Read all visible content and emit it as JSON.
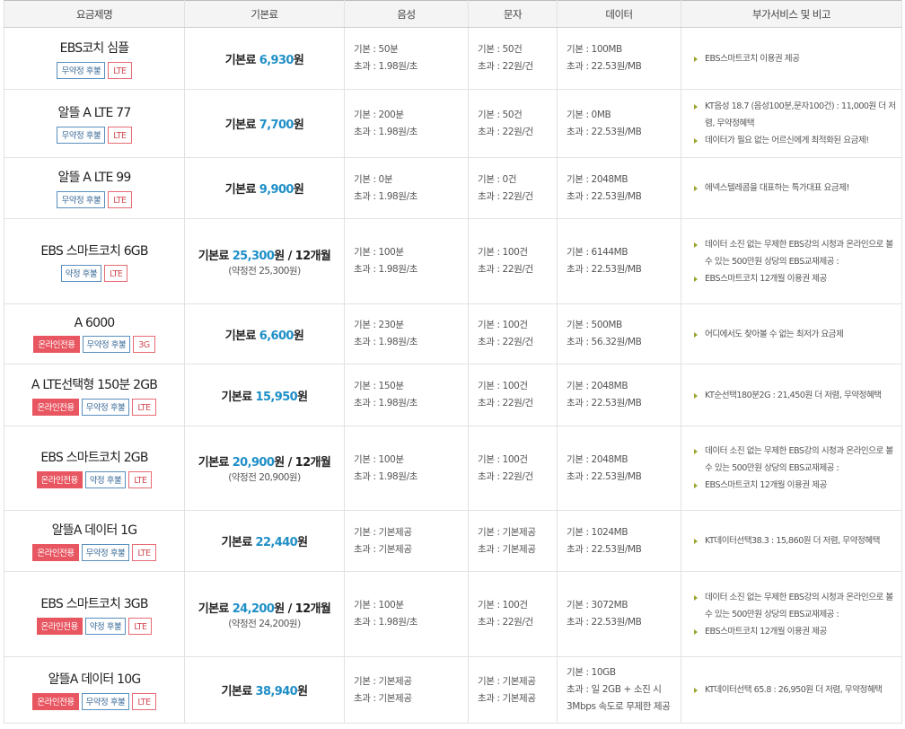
{
  "headers": [
    "요금제명",
    "기본료",
    "음성",
    "문자",
    "데이터",
    "부가서비스 및 비고"
  ],
  "plans": [
    {
      "name": "EBS코치 심플",
      "badges": [
        {
          "type": "contract",
          "label": "무약정 후불"
        },
        {
          "type": "net",
          "label": "LTE"
        }
      ],
      "fee": {
        "prefix": "기본료",
        "amount": "6,930",
        "unit": "원",
        "suffix": "",
        "sub": ""
      },
      "voice": [
        "기본 : 50분",
        "초과 : 1.98원/초"
      ],
      "sms": [
        "기본 : 50건",
        "초과 : 22원/건"
      ],
      "data": [
        "기본 : 100MB",
        "초과 : 22.53원/MB"
      ],
      "notes": [
        "EBS스마트코치 이용권 제공"
      ]
    },
    {
      "name": "알뜰 A LTE 77",
      "badges": [
        {
          "type": "contract",
          "label": "무약정 후불"
        },
        {
          "type": "net",
          "label": "LTE"
        }
      ],
      "fee": {
        "prefix": "기본료",
        "amount": "7,700",
        "unit": "원",
        "suffix": "",
        "sub": ""
      },
      "voice": [
        "기본 : 200분",
        "초과 : 1.98원/초"
      ],
      "sms": [
        "기본 : 50건",
        "초과 : 22원/건"
      ],
      "data": [
        "기본 : 0MB",
        "초과 : 22.53원/MB"
      ],
      "notes": [
        "KT음성 18.7 (음성100분,문자100건) : 11,000원 더 저렴, 무약정혜택",
        "데이터가 필요 없는 어르신에게 최적화된 요금제!"
      ]
    },
    {
      "name": "알뜰 A LTE 99",
      "badges": [
        {
          "type": "contract",
          "label": "무약정 후불"
        },
        {
          "type": "net",
          "label": "LTE"
        }
      ],
      "fee": {
        "prefix": "기본료",
        "amount": "9,900",
        "unit": "원",
        "suffix": "",
        "sub": ""
      },
      "voice": [
        "기본 : 0분",
        "초과 : 1.98원/초"
      ],
      "sms": [
        "기본 : 0건",
        "초과 : 22원/건"
      ],
      "data": [
        "기본 : 2048MB",
        "초과 : 22.53원/MB"
      ],
      "notes": [
        "에넥스텔레콤을 대표하는 특가대표 요금제!"
      ]
    },
    {
      "name": "EBS 스마트코치 6GB",
      "badges": [
        {
          "type": "contract",
          "label": "약정 후불"
        },
        {
          "type": "net",
          "label": "LTE"
        }
      ],
      "fee": {
        "prefix": "기본료",
        "amount": "25,300",
        "unit": "원",
        "suffix": " / 12개월",
        "sub": "(약정전 25,300원)"
      },
      "voice": [
        "기본 : 100분",
        "초과 : 1.98원/초"
      ],
      "sms": [
        "기본 : 100건",
        "초과 : 22원/건"
      ],
      "data": [
        "기본 : 6144MB",
        "초과 : 22.53원/MB"
      ],
      "notes": [
        "데이터 소진 없는 무제한 EBS강의 시청과 온라인으로 볼수 있는 500만원 상당의 EBS교재제공 :",
        "EBS스마트코치 12개월 이용권 제공"
      ]
    },
    {
      "name": "A 6000",
      "badges": [
        {
          "type": "online",
          "label": "온라인전용"
        },
        {
          "type": "contract",
          "label": "무약정 후불"
        },
        {
          "type": "net",
          "label": "3G"
        }
      ],
      "fee": {
        "prefix": "기본료",
        "amount": "6,600",
        "unit": "원",
        "suffix": "",
        "sub": ""
      },
      "voice": [
        "기본 : 230분",
        "초과 : 1.98원/초"
      ],
      "sms": [
        "기본 : 100건",
        "초과 : 22원/건"
      ],
      "data": [
        "기본 : 500MB",
        "초과 : 56.32원/MB"
      ],
      "notes": [
        "어디에서도 찾아볼 수 없는 최저가 요금제"
      ]
    },
    {
      "name": "A LTE선택형 150분 2GB",
      "badges": [
        {
          "type": "online",
          "label": "온라인전용"
        },
        {
          "type": "contract",
          "label": "무약정 후불"
        },
        {
          "type": "net",
          "label": "LTE"
        }
      ],
      "fee": {
        "prefix": "기본료",
        "amount": "15,950",
        "unit": "원",
        "suffix": "",
        "sub": ""
      },
      "voice": [
        "기본 : 150분",
        "초과 : 1.98원/초"
      ],
      "sms": [
        "기본 : 100건",
        "초과 : 22원/건"
      ],
      "data": [
        "기본 : 2048MB",
        "초과 : 22.53원/MB"
      ],
      "notes": [
        "KT순선택180분2G : 21,450원 더 저렴, 무약정혜택"
      ]
    },
    {
      "name": "EBS 스마트코치 2GB",
      "badges": [
        {
          "type": "online",
          "label": "온라인전용"
        },
        {
          "type": "contract",
          "label": "약정 후불"
        },
        {
          "type": "net",
          "label": "LTE"
        }
      ],
      "fee": {
        "prefix": "기본료",
        "amount": "20,900",
        "unit": "원",
        "suffix": " / 12개월",
        "sub": "(약정전 20,900원)"
      },
      "voice": [
        "기본 : 100분",
        "초과 : 1.98원/초"
      ],
      "sms": [
        "기본 : 100건",
        "초과 : 22원/건"
      ],
      "data": [
        "기본 : 2048MB",
        "초과 : 22.53원/MB"
      ],
      "notes": [
        "데이터 소진 없는 무제한 EBS강의 시청과 온라인으로 볼수 있는 500만원 상당의 EBS교재제공 :",
        "EBS스마트코치 12개월 이용권 제공"
      ]
    },
    {
      "name": "알뜰A 데이터 1G",
      "badges": [
        {
          "type": "online",
          "label": "온라인전용"
        },
        {
          "type": "contract",
          "label": "무약정 후불"
        },
        {
          "type": "net",
          "label": "LTE"
        }
      ],
      "fee": {
        "prefix": "기본료",
        "amount": "22,440",
        "unit": "원",
        "suffix": "",
        "sub": ""
      },
      "voice": [
        "기본 : 기본제공",
        "초과 : 기본제공"
      ],
      "sms": [
        "기본 : 기본제공",
        "초과 : 기본제공"
      ],
      "data": [
        "기본 : 1024MB",
        "초과 : 22.53원/MB"
      ],
      "notes": [
        "KT데이터선택38.3 : 15,860원 더 저렴, 무약정혜택"
      ]
    },
    {
      "name": "EBS 스마트코치 3GB",
      "badges": [
        {
          "type": "online",
          "label": "온라인전용"
        },
        {
          "type": "contract",
          "label": "약정 후불"
        },
        {
          "type": "net",
          "label": "LTE"
        }
      ],
      "fee": {
        "prefix": "기본료",
        "amount": "24,200",
        "unit": "원",
        "suffix": " / 12개월",
        "sub": "(약정전 24,200원)"
      },
      "voice": [
        "기본 : 100분",
        "초과 : 1.98원/초"
      ],
      "sms": [
        "기본 : 100건",
        "초과 : 22원/건"
      ],
      "data": [
        "기본 : 3072MB",
        "초과 : 22.53원/MB"
      ],
      "notes": [
        "데이터 소진 없는 무제한 EBS강의 시청과 온라인으로 볼수 있는 500만원 상당의 EBS교재제공 :",
        "EBS스마트코치 12개월 이용권 제공"
      ]
    },
    {
      "name": "알뜰A 데이터 10G",
      "badges": [
        {
          "type": "online",
          "label": "온라인전용"
        },
        {
          "type": "contract",
          "label": "무약정 후불"
        },
        {
          "type": "net",
          "label": "LTE"
        }
      ],
      "fee": {
        "prefix": "기본료",
        "amount": "38,940",
        "unit": "원",
        "suffix": "",
        "sub": ""
      },
      "voice": [
        "기본 : 기본제공",
        "초과 : 기본제공"
      ],
      "sms": [
        "기본 : 기본제공",
        "초과 : 기본제공"
      ],
      "data": [
        "기본 : 10GB",
        "초과 : 일 2GB + 소진 시",
        "3Mbps 속도로 무제한 제공"
      ],
      "notes": [
        "KT데이터선택 65.8 : 26,950원 더 저렴, 무약정혜택"
      ]
    }
  ]
}
